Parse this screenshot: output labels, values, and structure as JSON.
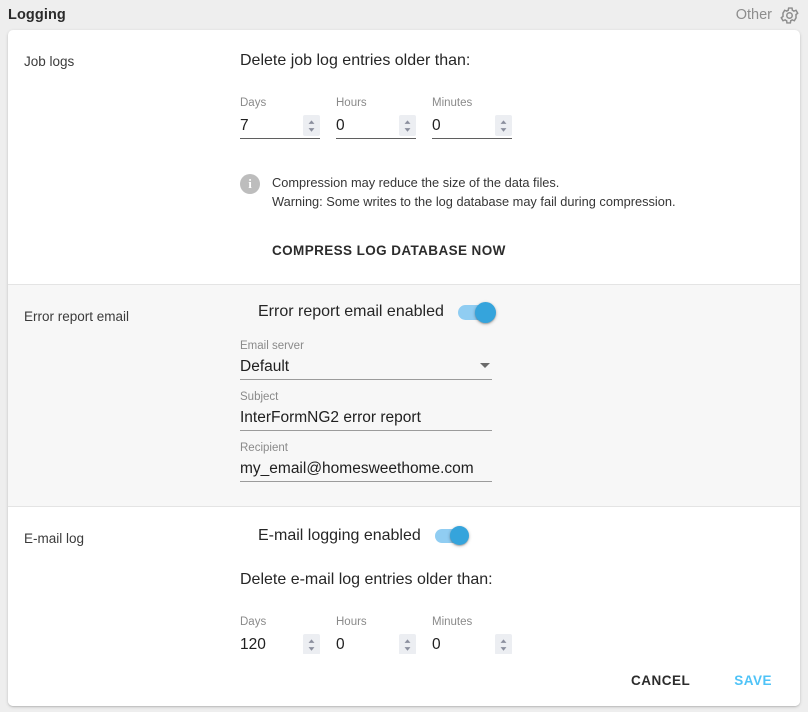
{
  "header": {
    "title": "Logging",
    "right_label": "Other",
    "gear_icon": "gear-icon"
  },
  "sections": [
    {
      "label": "Job logs",
      "heading": "Delete job log entries older than:",
      "fields": [
        {
          "label": "Days",
          "value": "7"
        },
        {
          "label": "Hours",
          "value": "0"
        },
        {
          "label": "Minutes",
          "value": "0"
        }
      ],
      "note": {
        "icon": "info-icon",
        "glyph": "i",
        "line1": "Compression may reduce the size of the data files.",
        "line2": "Warning: Some writes to the log database may fail during compression."
      },
      "action_label": "COMPRESS LOG DATABASE NOW"
    },
    {
      "label": "Error report email",
      "toggle": {
        "label": "Error report email enabled",
        "state": "on"
      },
      "email_server": {
        "label": "Email server",
        "value": "Default",
        "caret_icon": "chevron-down-icon"
      },
      "subject": {
        "label": "Subject",
        "value": "InterFormNG2 error report"
      },
      "recipient": {
        "label": "Recipient",
        "value": "my_email@homesweethome.com"
      }
    },
    {
      "label": "E-mail log",
      "toggle": {
        "label": "E-mail logging enabled",
        "state": "on"
      },
      "heading": "Delete e-mail log entries older than:",
      "fields": [
        {
          "label": "Days",
          "value": "120"
        },
        {
          "label": "Hours",
          "value": "0"
        },
        {
          "label": "Minutes",
          "value": "0"
        }
      ]
    }
  ],
  "footer": {
    "cancel_label": "CANCEL",
    "save_label": "SAVE"
  },
  "colors": {
    "accent": "#4fc3f7",
    "toggle_thumb": "#35a4dc",
    "toggle_track": "#90cdf2",
    "page_bg": "#eeeeee",
    "alt_section_bg": "#f7f7f7"
  }
}
